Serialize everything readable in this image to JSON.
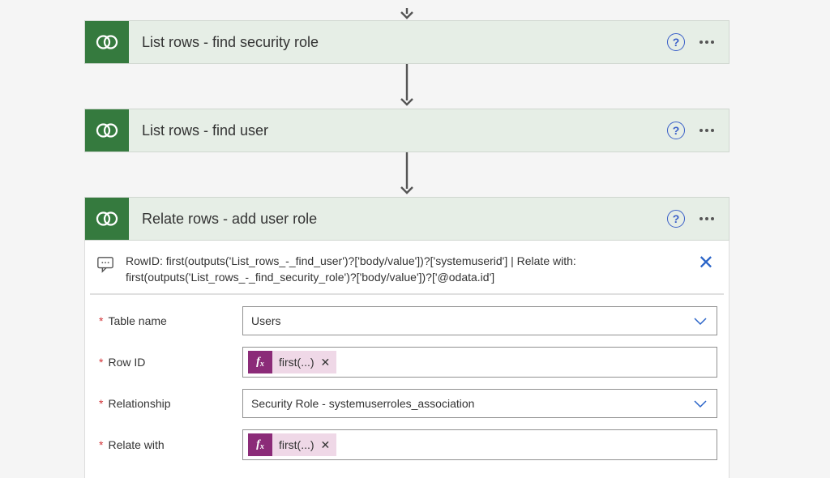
{
  "steps": {
    "findRole": {
      "title": "List rows - find security role"
    },
    "findUser": {
      "title": "List rows - find user"
    },
    "relate": {
      "title": "Relate rows - add user role"
    }
  },
  "comment": "RowID: first(outputs('List_rows_-_find_user')?['body/value'])?['systemuserid'] | Relate with: first(outputs('List_rows_-_find_security_role')?['body/value'])?['@odata.id']",
  "form": {
    "tableName": {
      "label": "Table name",
      "value": "Users"
    },
    "rowId": {
      "label": "Row ID",
      "chip": "first(...)"
    },
    "relationship": {
      "label": "Relationship",
      "value": "Security Role - systemuserroles_association"
    },
    "relateWith": {
      "label": "Relate with",
      "chip": "first(...)"
    }
  },
  "requiredMarker": "*",
  "fxLabel": "f",
  "fxSub": "x"
}
